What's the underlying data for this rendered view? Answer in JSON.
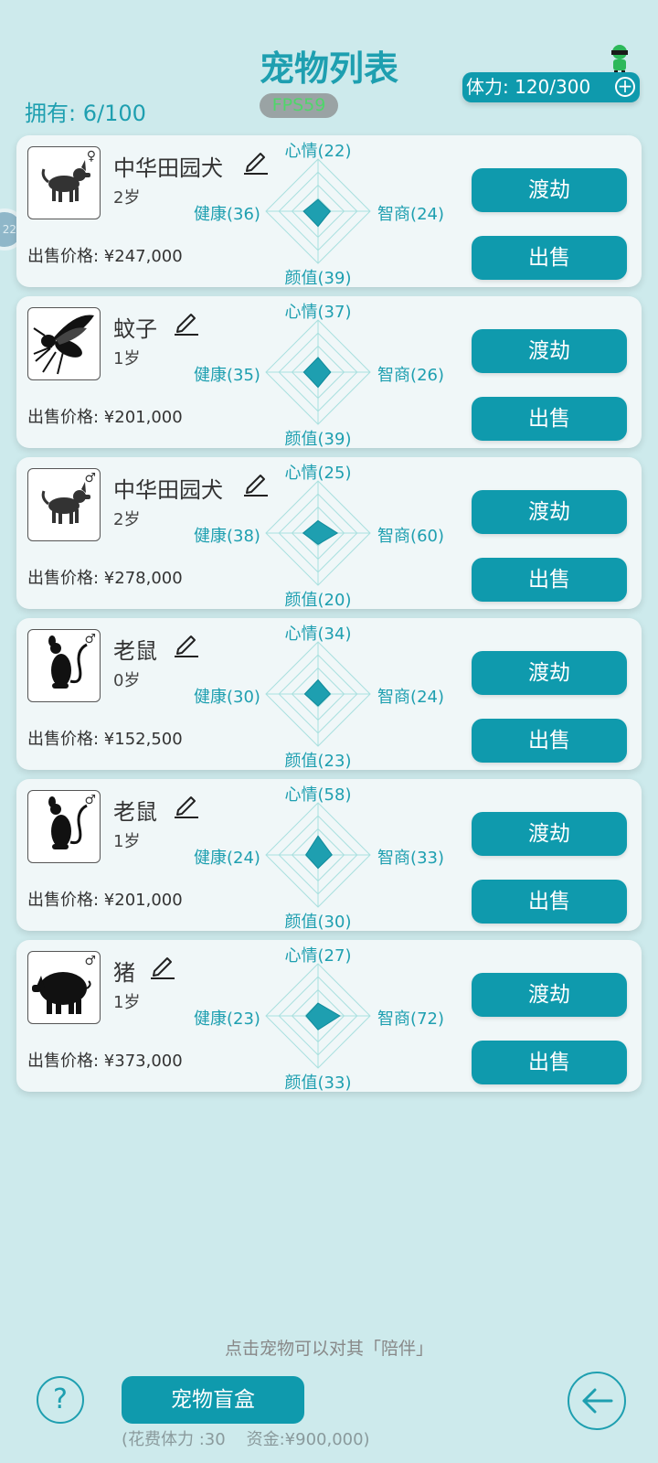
{
  "header": {
    "title": "宠物列表",
    "owned": "拥有: 6/100",
    "fps": "FPS59",
    "stamina": "体力: 120/300",
    "side_badge": "22"
  },
  "pets": [
    {
      "name": "中华田园犬",
      "age": "2岁",
      "price": "出售价格: ¥247,000",
      "gender": "♀",
      "icon": "dog-icon",
      "stats": {
        "mood": "心情(22)",
        "intel": "智商(24)",
        "looks": "颜值(39)",
        "health": "健康(36)"
      },
      "values": {
        "mood": 22,
        "intel": 24,
        "looks": 39,
        "health": 36
      },
      "btn1": "渡劫",
      "btn2": "出售"
    },
    {
      "name": "蚊子",
      "age": "1岁",
      "price": "出售价格: ¥201,000",
      "gender": "",
      "icon": "mosquito-icon",
      "stats": {
        "mood": "心情(37)",
        "intel": "智商(26)",
        "looks": "颜值(39)",
        "health": "健康(35)"
      },
      "values": {
        "mood": 37,
        "intel": 26,
        "looks": 39,
        "health": 35
      },
      "btn1": "渡劫",
      "btn2": "出售"
    },
    {
      "name": "中华田园犬",
      "age": "2岁",
      "price": "出售价格: ¥278,000",
      "gender": "♂",
      "icon": "dog-icon",
      "stats": {
        "mood": "心情(25)",
        "intel": "智商(60)",
        "looks": "颜值(20)",
        "health": "健康(38)"
      },
      "values": {
        "mood": 25,
        "intel": 60,
        "looks": 20,
        "health": 38
      },
      "btn1": "渡劫",
      "btn2": "出售"
    },
    {
      "name": "老鼠",
      "age": "0岁",
      "price": "出售价格: ¥152,500",
      "gender": "♂",
      "icon": "rat-icon",
      "stats": {
        "mood": "心情(34)",
        "intel": "智商(24)",
        "looks": "颜值(23)",
        "health": "健康(30)"
      },
      "values": {
        "mood": 34,
        "intel": 24,
        "looks": 23,
        "health": 30
      },
      "btn1": "渡劫",
      "btn2": "出售"
    },
    {
      "name": "老鼠",
      "age": "1岁",
      "price": "出售价格: ¥201,000",
      "gender": "♂",
      "icon": "rat-icon",
      "stats": {
        "mood": "心情(58)",
        "intel": "智商(33)",
        "looks": "颜值(30)",
        "health": "健康(24)"
      },
      "values": {
        "mood": 58,
        "intel": 33,
        "looks": 30,
        "health": 24
      },
      "btn1": "渡劫",
      "btn2": "出售"
    },
    {
      "name": "猪",
      "age": "1岁",
      "price": "出售价格: ¥373,000",
      "gender": "♂",
      "icon": "pig-icon",
      "stats": {
        "mood": "心情(27)",
        "intel": "智商(72)",
        "looks": "颜值(33)",
        "health": "健康(23)"
      },
      "values": {
        "mood": 27,
        "intel": 72,
        "looks": 33,
        "health": 23
      },
      "btn1": "渡劫",
      "btn2": "出售"
    }
  ],
  "footer": {
    "hint": "点击宠物可以对其「陪伴」",
    "help": "?",
    "blind_box": "宠物盲盒",
    "cost": "(花费体力 :30    资金:¥900,000)"
  }
}
